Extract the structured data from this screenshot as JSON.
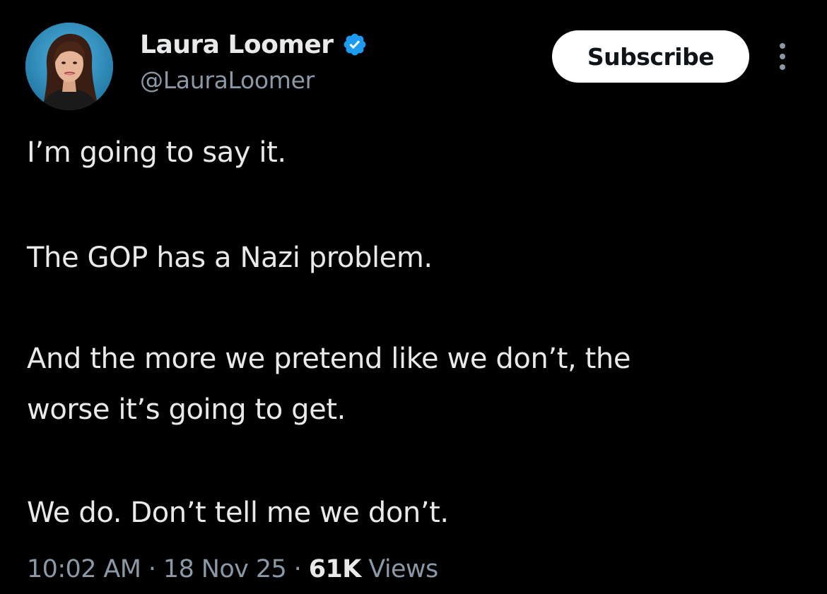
{
  "author": {
    "display_name": "Laura Loomer",
    "handle": "@LauraLoomer",
    "avatar_icon": "profile-photo",
    "verified_icon": "verified-badge-icon",
    "verified_color": "#1d9bf0"
  },
  "actions": {
    "subscribe_label": "Subscribe",
    "more_icon": "more-options-icon"
  },
  "tweet": {
    "lines": [
      "I’m going to say it.",
      "The GOP has a Nazi problem.",
      "And the more we pretend like we don’t, the",
      "worse it’s going to get.",
      "We do. Don’t tell me we don’t."
    ]
  },
  "meta": {
    "time": "10:02 AM",
    "separator": " · ",
    "date": "18 Nov 25",
    "views_count": "61K",
    "views_label": " Views"
  },
  "colors": {
    "background": "#000000",
    "text_primary": "#e7e9ea",
    "text_secondary": "#8b98a5",
    "button_bg": "#ffffff",
    "button_text": "#0f1419"
  }
}
